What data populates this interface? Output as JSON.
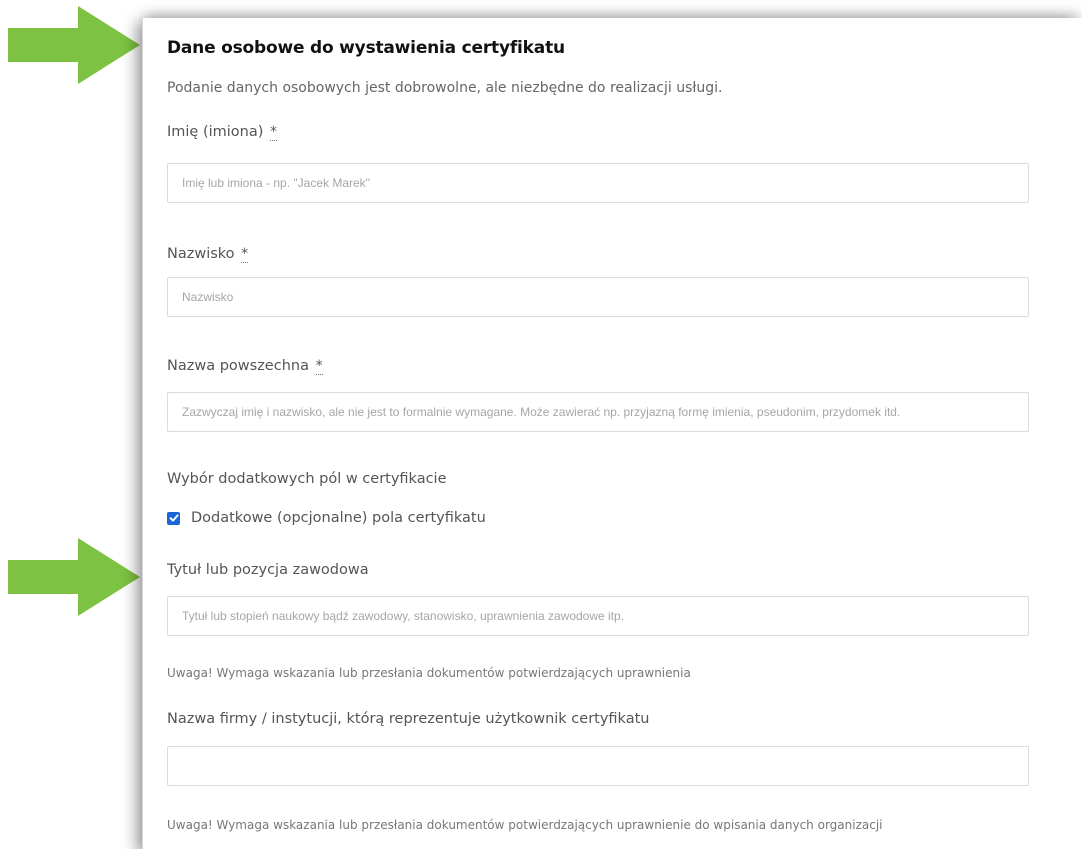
{
  "form": {
    "title": "Dane osobowe do wystawienia certyfikatu",
    "intro": "Podanie danych osobowych jest dobrowolne, ale niezbędne do realizacji usługi.",
    "required_marker": "*",
    "fields": {
      "first_name": {
        "label": "Imię (imiona)",
        "placeholder": "Imię lub imiona - np. \"Jacek Marek\"",
        "value": ""
      },
      "last_name": {
        "label": "Nazwisko",
        "placeholder": "Nazwisko",
        "value": ""
      },
      "common_name": {
        "label": "Nazwa powszechna",
        "placeholder": "Zazwyczaj imię i nazwisko, ale nie jest to formalnie wymagane. Może zawierać np. przyjazną formę imienia, pseudonim, przydomek itd.",
        "value": ""
      },
      "extra_fields": {
        "label": "Wybór dodatkowych pól w certyfikacie",
        "checkbox_label": "Dodatkowe (opcjonalne) pola certyfikatu",
        "checked": true
      },
      "title": {
        "label": "Tytuł lub pozycja zawodowa",
        "placeholder": "Tytuł lub stopień naukowy bądź zawodowy, stanowisko, uprawnienia zawodowe itp.",
        "value": "",
        "note": "Uwaga! Wymaga wskazania lub przesłania dokumentów potwierdzających uprawnienia"
      },
      "organization": {
        "label": "Nazwa firmy / instytucji, którą reprezentuje użytkownik certyfikatu",
        "placeholder": "",
        "value": "",
        "note": "Uwaga! Wymaga wskazania lub przesłania dokumentów potwierdzających uprawnienie do wpisania danych organizacji"
      }
    }
  },
  "annotations": {
    "arrow_icon": "right-arrow-icon",
    "arrow_color": "#7dc242"
  },
  "colors": {
    "checkbox_accent": "#1a66d6",
    "label_text": "#555555",
    "placeholder_text": "#a6a6a6"
  }
}
